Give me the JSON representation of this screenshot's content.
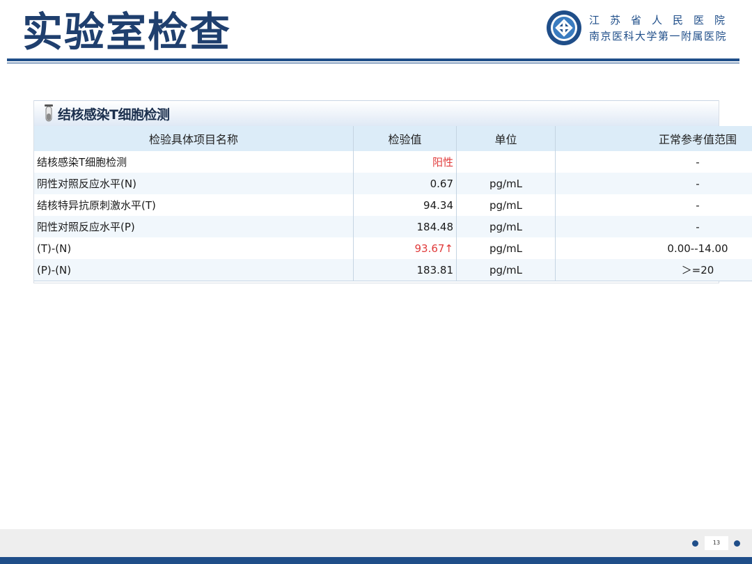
{
  "slide": {
    "title": "实验室检查",
    "hospital_line1": "江苏省人民医院",
    "hospital_line2": "南京医科大学第一附属医院",
    "page_number": "13"
  },
  "report": {
    "title": "结核感染T细胞检测",
    "columns": [
      "检验具体项目名称",
      "检验值",
      "单位",
      "正常参考值范围"
    ],
    "rows": [
      {
        "name": "结核感染T细胞检测",
        "value": "阳性",
        "unit": "",
        "range": "-"
      },
      {
        "name": "阴性对照反应水平(N)",
        "value": "0.67",
        "unit": "pg/mL",
        "range": "-"
      },
      {
        "name": "结核特异抗原刺激水平(T)",
        "value": "94.34",
        "unit": "pg/mL",
        "range": "-"
      },
      {
        "name": "阳性对照反应水平(P)",
        "value": "184.48",
        "unit": "pg/mL",
        "range": "-"
      },
      {
        "name": "(T)-(N)",
        "value": "93.67↑",
        "unit": "pg/mL",
        "range": "0.00--14.00"
      },
      {
        "name": "(P)-(N)",
        "value": "183.81",
        "unit": "pg/mL",
        "range": "＞=20"
      }
    ]
  },
  "colors": {
    "brand_blue": "#1f4e89",
    "abnormal_red": "#e03a3a",
    "header_blue": "#dcecf8"
  },
  "icons": {
    "logo": "hospital-logo-icon",
    "tube": "test-tube-icon"
  }
}
